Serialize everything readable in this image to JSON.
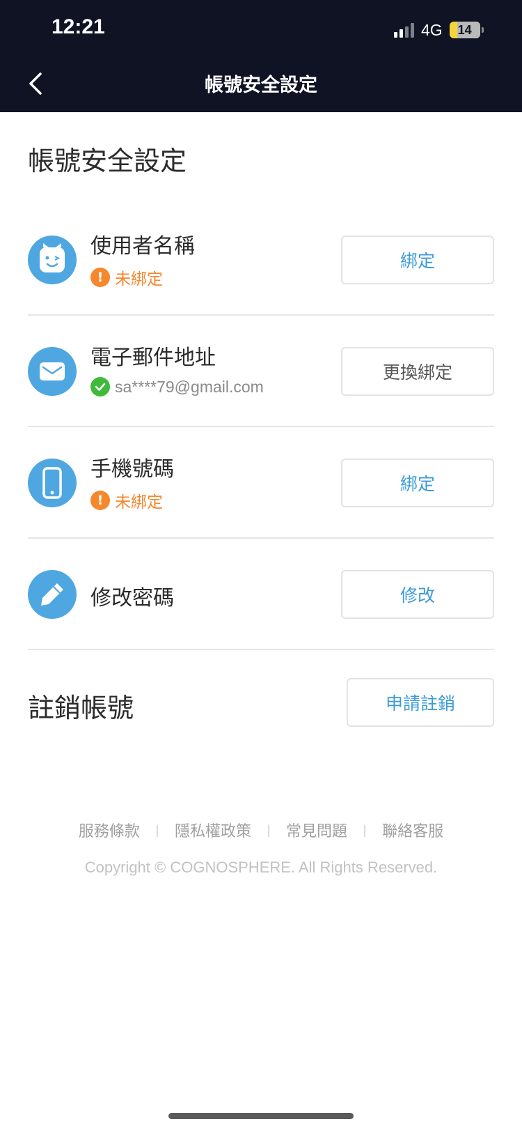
{
  "status_bar": {
    "time": "12:21",
    "network": "4G",
    "battery_level": "14"
  },
  "nav": {
    "title": "帳號安全設定"
  },
  "page": {
    "heading": "帳號安全設定"
  },
  "rows": [
    {
      "label": "使用者名稱",
      "icon": "face-icon",
      "status": "未綁定",
      "status_type": "warning",
      "button": "綁定"
    },
    {
      "label": "電子郵件地址",
      "icon": "envelope-icon",
      "status": "sa****79@gmail.com",
      "status_type": "ok",
      "button": "更換綁定"
    },
    {
      "label": "手機號碼",
      "icon": "phone-icon",
      "status": "未綁定",
      "status_type": "warning",
      "button": "綁定"
    },
    {
      "label": "修改密碼",
      "icon": "pencil-icon",
      "button": "修改"
    }
  ],
  "cancel_account": {
    "label": "註銷帳號",
    "button": "申請註銷"
  },
  "footer": {
    "links": [
      "服務條款",
      "隱私權政策",
      "常見問題",
      "聯絡客服"
    ],
    "copyright": "Copyright © COGNOSPHERE. All Rights Reserved."
  },
  "colors": {
    "header_bg": "#0f1324",
    "accent_blue": "#3a9bd7",
    "icon_blue": "#4ea7e1",
    "warning_orange": "#f5872d",
    "ok_green": "#3fba3b"
  }
}
